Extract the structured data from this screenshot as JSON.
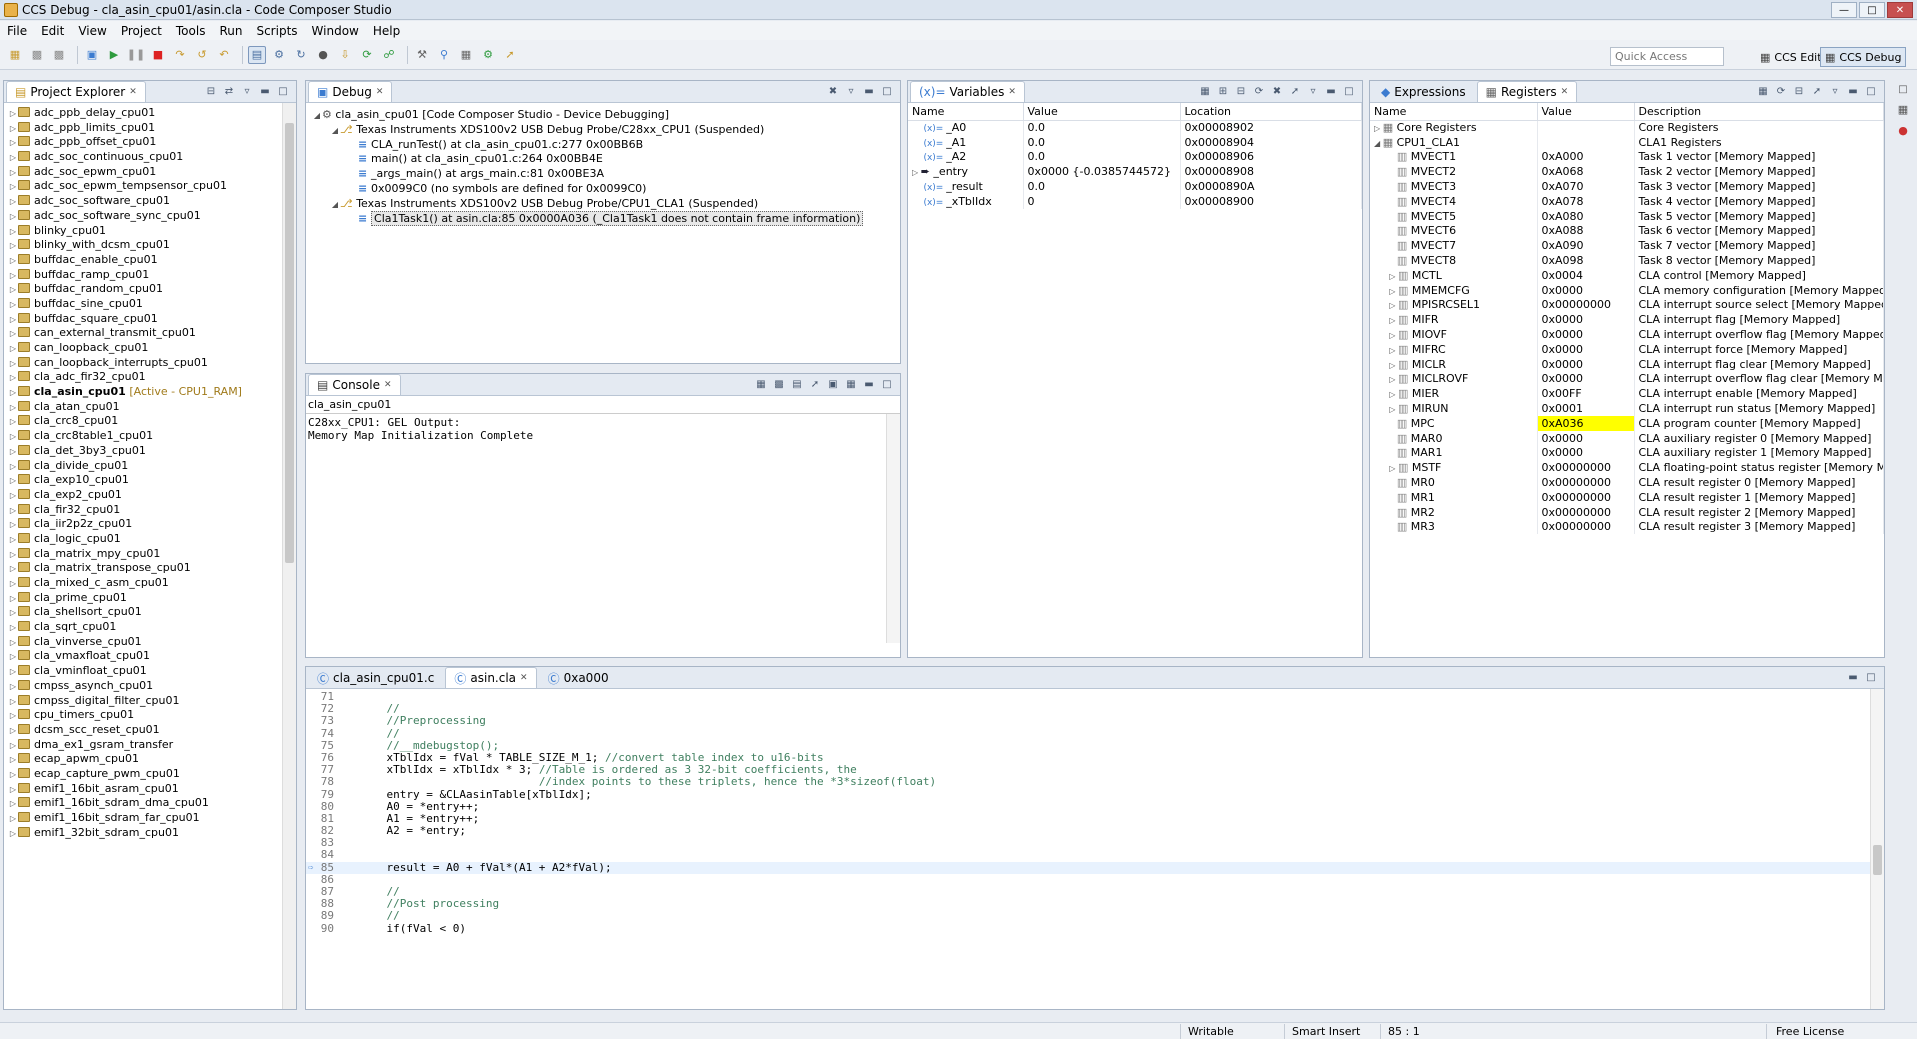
{
  "window": {
    "title": "CCS Debug - cla_asin_cpu01/asin.cla - Code Composer Studio"
  },
  "menu": [
    "File",
    "Edit",
    "View",
    "Project",
    "Tools",
    "Run",
    "Scripts",
    "Window",
    "Help"
  ],
  "quick_access": "Quick Access",
  "perspectives": {
    "edit": "CCS Edit",
    "debug": "CCS Debug"
  },
  "project_explorer": {
    "title": "Project Explorer",
    "items": [
      "adc_ppb_delay_cpu01",
      "adc_ppb_limits_cpu01",
      "adc_ppb_offset_cpu01",
      "adc_soc_continuous_cpu01",
      "adc_soc_epwm_cpu01",
      "adc_soc_epwm_tempsensor_cpu01",
      "adc_soc_software_cpu01",
      "adc_soc_software_sync_cpu01",
      "blinky_cpu01",
      "blinky_with_dcsm_cpu01",
      "buffdac_enable_cpu01",
      "buffdac_ramp_cpu01",
      "buffdac_random_cpu01",
      "buffdac_sine_cpu01",
      "buffdac_square_cpu01",
      "can_external_transmit_cpu01",
      "can_loopback_cpu01",
      "can_loopback_interrupts_cpu01",
      "cla_adc_fir32_cpu01",
      "cla_asin_cpu01",
      "cla_atan_cpu01",
      "cla_crc8_cpu01",
      "cla_crc8table1_cpu01",
      "cla_det_3by3_cpu01",
      "cla_divide_cpu01",
      "cla_exp10_cpu01",
      "cla_exp2_cpu01",
      "cla_fir32_cpu01",
      "cla_iir2p2z_cpu01",
      "cla_logic_cpu01",
      "cla_matrix_mpy_cpu01",
      "cla_matrix_transpose_cpu01",
      "cla_mixed_c_asm_cpu01",
      "cla_prime_cpu01",
      "cla_shellsort_cpu01",
      "cla_sqrt_cpu01",
      "cla_vinverse_cpu01",
      "cla_vmaxfloat_cpu01",
      "cla_vminfloat_cpu01",
      "cmpss_asynch_cpu01",
      "cmpss_digital_filter_cpu01",
      "cpu_timers_cpu01",
      "dcsm_scc_reset_cpu01",
      "dma_ex1_gsram_transfer",
      "ecap_apwm_cpu01",
      "ecap_capture_pwm_cpu01",
      "emif1_16bit_asram_cpu01",
      "emif1_16bit_sdram_dma_cpu01",
      "emif1_16bit_sdram_far_cpu01",
      "emif1_32bit_sdram_cpu01"
    ],
    "active_index": 19,
    "active_suffix": "[Active - CPU1_RAM]"
  },
  "debug": {
    "title": "Debug",
    "rows": [
      {
        "level": 0,
        "text": "cla_asin_cpu01 [Code Composer Studio - Device Debugging]"
      },
      {
        "level": 1,
        "text": "Texas Instruments XDS100v2 USB Debug Probe/C28xx_CPU1 (Suspended)"
      },
      {
        "level": 2,
        "text": "CLA_runTest() at cla_asin_cpu01.c:277 0x00BB6B"
      },
      {
        "level": 2,
        "text": "main() at cla_asin_cpu01.c:264 0x00BB4E"
      },
      {
        "level": 2,
        "text": "_args_main() at args_main.c:81 0x00BE3A"
      },
      {
        "level": 2,
        "text": "0x0099C0  (no symbols are defined for 0x0099C0)"
      },
      {
        "level": 1,
        "text": "Texas Instruments XDS100v2 USB Debug Probe/CPU1_CLA1 (Suspended)"
      },
      {
        "level": 2,
        "text": "Cla1Task1() at asin.cla:85 0x0000A036  (_Cla1Task1 does not contain frame information)",
        "selected": true
      }
    ]
  },
  "console": {
    "title": "Console",
    "context": "cla_asin_cpu01",
    "lines": [
      "C28xx_CPU1: GEL Output:",
      "Memory Map Initialization Complete"
    ]
  },
  "variables": {
    "title": "Variables",
    "headers": [
      "Name",
      "Value",
      "Location"
    ],
    "rows": [
      {
        "name": "_A0",
        "value": "0.0",
        "location": "0x00008902"
      },
      {
        "name": "_A1",
        "value": "0.0",
        "location": "0x00008904"
      },
      {
        "name": "_A2",
        "value": "0.0",
        "location": "0x00008906"
      },
      {
        "name": "_entry",
        "value": "0x0000 {-0.0385744572}",
        "location": "0x00008908"
      },
      {
        "name": "_result",
        "value": "0.0",
        "location": "0x0000890A"
      },
      {
        "name": "_xTblIdx",
        "value": "0",
        "location": "0x00008900"
      }
    ]
  },
  "registers": {
    "expressions_tab": "Expressions",
    "title": "Registers",
    "headers": [
      "Name",
      "Value",
      "Description"
    ],
    "rows": [
      {
        "name": "Core Registers",
        "value": "",
        "desc": "Core Registers",
        "group": true,
        "expanded": false
      },
      {
        "name": "CPU1_CLA1",
        "value": "",
        "desc": "CLA1 Registers",
        "group": true,
        "expanded": true
      },
      {
        "name": "MVECT1",
        "value": "0xA000",
        "desc": "Task 1 vector [Memory Mapped]"
      },
      {
        "name": "MVECT2",
        "value": "0xA068",
        "desc": "Task 2 vector [Memory Mapped]"
      },
      {
        "name": "MVECT3",
        "value": "0xA070",
        "desc": "Task 3 vector [Memory Mapped]"
      },
      {
        "name": "MVECT4",
        "value": "0xA078",
        "desc": "Task 4 vector [Memory Mapped]"
      },
      {
        "name": "MVECT5",
        "value": "0xA080",
        "desc": "Task 5 vector [Memory Mapped]"
      },
      {
        "name": "MVECT6",
        "value": "0xA088",
        "desc": "Task 6 vector [Memory Mapped]"
      },
      {
        "name": "MVECT7",
        "value": "0xA090",
        "desc": "Task 7 vector [Memory Mapped]"
      },
      {
        "name": "MVECT8",
        "value": "0xA098",
        "desc": "Task 8 vector [Memory Mapped]"
      },
      {
        "name": "MCTL",
        "value": "0x0004",
        "desc": "CLA control [Memory Mapped]",
        "exp": true
      },
      {
        "name": "MMEMCFG",
        "value": "0x0000",
        "desc": "CLA memory configuration [Memory Mapped]",
        "exp": true
      },
      {
        "name": "MPISRCSEL1",
        "value": "0x00000000",
        "desc": "CLA interrupt source select [Memory Mapped]",
        "exp": true
      },
      {
        "name": "MIFR",
        "value": "0x0000",
        "desc": "CLA interrupt flag [Memory Mapped]",
        "exp": true
      },
      {
        "name": "MIOVF",
        "value": "0x0000",
        "desc": "CLA interrupt overflow flag [Memory Mapped]",
        "exp": true
      },
      {
        "name": "MIFRC",
        "value": "0x0000",
        "desc": "CLA interrupt force [Memory Mapped]",
        "exp": true
      },
      {
        "name": "MICLR",
        "value": "0x0000",
        "desc": "CLA interrupt flag clear [Memory Mapped]",
        "exp": true
      },
      {
        "name": "MICLROVF",
        "value": "0x0000",
        "desc": "CLA interrupt overflow flag clear [Memory Map",
        "exp": true
      },
      {
        "name": "MIER",
        "value": "0x00FF",
        "desc": "CLA interrupt enable [Memory Mapped]",
        "exp": true
      },
      {
        "name": "MIRUN",
        "value": "0x0001",
        "desc": "CLA interrupt run status [Memory Mapped]",
        "exp": true
      },
      {
        "name": "MPC",
        "value": "0xA036",
        "desc": "CLA program counter [Memory Mapped]",
        "highlight": true
      },
      {
        "name": "MAR0",
        "value": "0x0000",
        "desc": "CLA auxiliary register 0 [Memory Mapped]"
      },
      {
        "name": "MAR1",
        "value": "0x0000",
        "desc": "CLA auxiliary register 1 [Memory Mapped]"
      },
      {
        "name": "MSTF",
        "value": "0x00000000",
        "desc": "CLA floating-point status register [Memory Ma",
        "exp": true
      },
      {
        "name": "MR0",
        "value": "0x00000000",
        "desc": "CLA result register 0 [Memory Mapped]"
      },
      {
        "name": "MR1",
        "value": "0x00000000",
        "desc": "CLA result register 1 [Memory Mapped]"
      },
      {
        "name": "MR2",
        "value": "0x00000000",
        "desc": "CLA result register 2 [Memory Mapped]"
      },
      {
        "name": "MR3",
        "value": "0x00000000",
        "desc": "CLA result register 3 [Memory Mapped]"
      }
    ]
  },
  "editor": {
    "tabs": [
      {
        "label": "cla_asin_cpu01.c",
        "active": false
      },
      {
        "label": "asin.cla",
        "active": true
      },
      {
        "label": "0xa000",
        "active": false
      }
    ],
    "current_line": 85,
    "lines": [
      {
        "n": 71,
        "code": "",
        "comment": ""
      },
      {
        "n": 72,
        "code": "    ",
        "comment": "//"
      },
      {
        "n": 73,
        "code": "    ",
        "comment": "//Preprocessing"
      },
      {
        "n": 74,
        "code": "    ",
        "comment": "//"
      },
      {
        "n": 75,
        "code": "    ",
        "comment": "//__mdebugstop();"
      },
      {
        "n": 76,
        "code": "    xTblIdx = fVal * TABLE_SIZE_M_1; ",
        "comment": "//convert table index to u16-bits"
      },
      {
        "n": 77,
        "code": "    xTblIdx = xTblIdx * 3; ",
        "comment": "//Table is ordered as 3 32-bit coefficients, the"
      },
      {
        "n": 78,
        "code": "                           ",
        "comment": "//index points to these triplets, hence the *3*sizeof(float)"
      },
      {
        "n": 79,
        "code": "    entry = &CLAasinTable[xTblIdx];",
        "comment": ""
      },
      {
        "n": 80,
        "code": "    A0 = *entry++;",
        "comment": ""
      },
      {
        "n": 81,
        "code": "    A1 = *entry++;",
        "comment": ""
      },
      {
        "n": 82,
        "code": "    A2 = *entry;",
        "comment": ""
      },
      {
        "n": 83,
        "code": "",
        "comment": ""
      },
      {
        "n": 84,
        "code": "",
        "comment": ""
      },
      {
        "n": 85,
        "code": "    result = A0 + fVal*(A1 + A2*fVal);",
        "comment": ""
      },
      {
        "n": 86,
        "code": "",
        "comment": ""
      },
      {
        "n": 87,
        "code": "    ",
        "comment": "//"
      },
      {
        "n": 88,
        "code": "    ",
        "comment": "//Post processing"
      },
      {
        "n": 89,
        "code": "    ",
        "comment": "//"
      },
      {
        "n": 90,
        "code": "    if(fVal < 0)",
        "comment": ""
      }
    ]
  },
  "status": {
    "writable": "Writable",
    "insert_mode": "Smart Insert",
    "position": "85 : 1",
    "license": "Free License"
  }
}
